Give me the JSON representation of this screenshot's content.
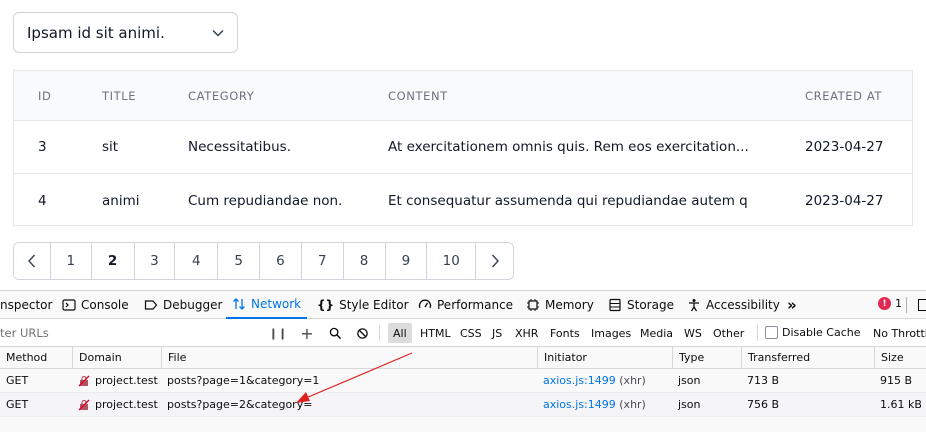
{
  "select": {
    "value": "Ipsam id sit animi."
  },
  "table": {
    "headers": {
      "id": "ID",
      "title": "TITLE",
      "category": "CATEGORY",
      "content": "CONTENT",
      "created": "CREATED AT"
    },
    "rows": [
      {
        "id": "3",
        "title": "sit",
        "category": "Necessitatibus.",
        "content": "At exercitationem omnis quis. Rem eos exercitation...",
        "created": "2023-04-27"
      },
      {
        "id": "4",
        "title": "animi",
        "category": "Cum repudiandae non.",
        "content": "Et consequatur assumenda qui repudiandae autem qui...",
        "created": "2023-04-27"
      }
    ]
  },
  "pagination": {
    "pages": [
      "1",
      "2",
      "3",
      "4",
      "5",
      "6",
      "7",
      "8",
      "9",
      "10"
    ],
    "current": "2"
  },
  "devtools": {
    "tabs": {
      "inspector": "nspector",
      "console": "Console",
      "debugger": "Debugger",
      "network": "Network",
      "style_editor": "Style Editor",
      "performance": "Performance",
      "memory": "Memory",
      "storage": "Storage",
      "accessibility": "Accessibility"
    },
    "error_count": "1",
    "filter_placeholder": "ter URLs",
    "filter_types": [
      "All",
      "HTML",
      "CSS",
      "JS",
      "XHR",
      "Fonts",
      "Images",
      "Media",
      "WS",
      "Other"
    ],
    "disable_cache": "Disable Cache",
    "throttling": "No Throttlin",
    "columns": {
      "method": "Method",
      "domain": "Domain",
      "file": "File",
      "initiator": "Initiator",
      "type": "Type",
      "transferred": "Transferred",
      "size": "Size"
    },
    "requests": [
      {
        "method": "GET",
        "domain": "project.test",
        "file": "posts?page=1&category=1",
        "initiator_link": "axios.js:1499",
        "initiator_kind": "(xhr)",
        "type": "json",
        "transferred": "713 B",
        "size": "915 B"
      },
      {
        "method": "GET",
        "domain": "project.test",
        "file": "posts?page=2&category=",
        "initiator_link": "axios.js:1499",
        "initiator_kind": "(xhr)",
        "type": "json",
        "transferred": "756 B",
        "size": "1.61 kB"
      }
    ],
    "accent_color": "#0074e8"
  }
}
